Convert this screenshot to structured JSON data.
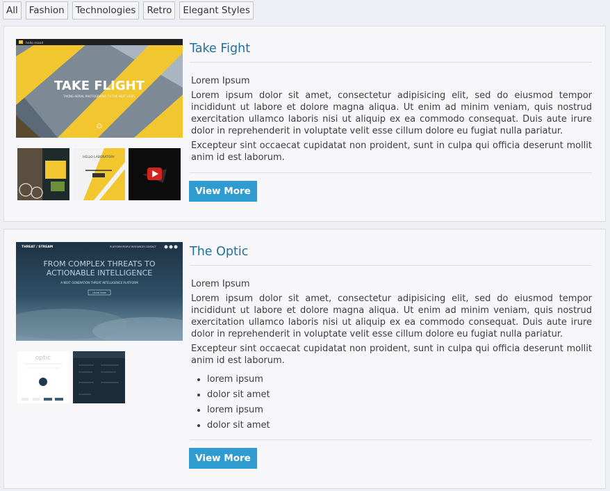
{
  "filters": [
    "All",
    "Fashion",
    "Technologies",
    "Retro",
    "Elegant Styles"
  ],
  "cards": [
    {
      "title": "Take Fight",
      "subhead": "Lorem Ipsum",
      "paragraph1": "Lorem ipsum dolor sit amet, consectetur adipisicing elit, sed do eiusmod tempor incididunt ut labore et dolore magna aliqua. Ut enim ad minim veniam, quis nostrud exercitation ullamco laboris nisi ut aliquip ex ea commodo consequat. Duis aute irure dolor in reprehenderit in voluptate velit esse cillum dolore eu fugiat nulla pariatur.",
      "paragraph2": "Excepteur sint occaecat cupidatat non proident, sunt in culpa qui officia deserunt mollit anim id est laborum.",
      "button": "View More",
      "main_image": {
        "headline": "TAKE FLIGHT",
        "tagline": "TAKING AERIAL PHOTOGRAPHY TO THE NEXT LEVEL",
        "brand": "hello mood"
      },
      "thumb2_label": "HELLO LABORATORY"
    },
    {
      "title": "The Optic",
      "subhead": "Lorem Ipsum",
      "paragraph1": "Lorem ipsum dolor sit amet, consectetur adipisicing elit, sed do eiusmod tempor incididunt ut labore et dolore magna aliqua. Ut enim ad minim veniam, quis nostrud exercitation ullamco laboris nisi ut aliquip ex ea commodo consequat. Duis aute irure dolor in reprehenderit in voluptate velit esse cillum dolore eu fugiat nulla pariatur.",
      "paragraph2": "Excepteur sint occaecat cupidatat non proident, sunt in culpa qui officia deserunt mollit anim id est laborum.",
      "list": [
        "lorem ipsum",
        "dolor sit amet",
        "lorem ipsum",
        "dolor sit amet"
      ],
      "button": "View More",
      "main_image": {
        "brand": "THREAT / STREAM",
        "headline1": "FROM COMPLEX THREATS TO",
        "headline2": "ACTIONABLE INTELLIGENCE",
        "tagline": "A NEXT GENERATION THREAT INTELLIGENCE PLATFORM",
        "cta": "LEARN MORE",
        "nav": "PLATFORM  PEOPLE  RESOURCES  CONTACT"
      },
      "thumb1_label": "optic"
    }
  ],
  "colors": {
    "accent": "#2f9bd0",
    "title": "#1f6f9c",
    "flight_yellow": "#f2c62f"
  }
}
